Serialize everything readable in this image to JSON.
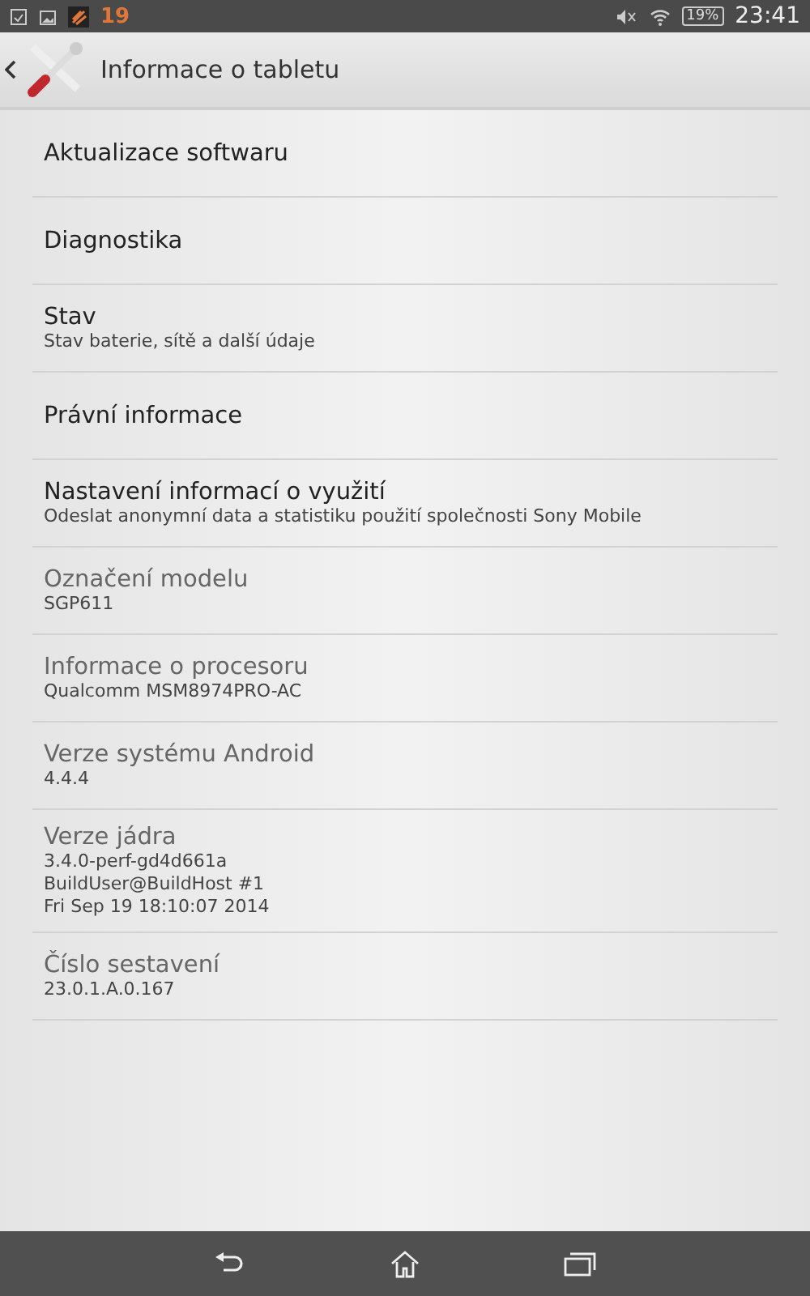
{
  "status_bar": {
    "notification_count": "19",
    "battery": "19%",
    "time": "23:41"
  },
  "action_bar": {
    "title": "Informace o tabletu"
  },
  "items": [
    {
      "title": "Aktualizace softwaru",
      "disabled": false
    },
    {
      "title": "Diagnostika",
      "disabled": false
    },
    {
      "title": "Stav",
      "subtitle": [
        "Stav baterie, sítě a další údaje"
      ],
      "disabled": false
    },
    {
      "title": "Právní informace",
      "disabled": false
    },
    {
      "title": "Nastavení informací o využití",
      "subtitle": [
        "Odeslat anonymní data a statistiku použití společnosti Sony Mobile"
      ],
      "disabled": false
    },
    {
      "title": "Označení modelu",
      "subtitle": [
        "SGP611"
      ],
      "disabled": true
    },
    {
      "title": "Informace o procesoru",
      "subtitle": [
        "Qualcomm MSM8974PRO-AC"
      ],
      "disabled": true
    },
    {
      "title": "Verze systému Android",
      "subtitle": [
        "4.4.4"
      ],
      "disabled": true
    },
    {
      "title": "Verze jádra",
      "subtitle": [
        "3.4.0-perf-gd4d661a",
        "BuildUser@BuildHost #1",
        "Fri Sep 19 18:10:07 2014"
      ],
      "disabled": true
    },
    {
      "title": "Číslo sestavení",
      "subtitle": [
        "23.0.1.A.0.167"
      ],
      "disabled": true
    }
  ]
}
